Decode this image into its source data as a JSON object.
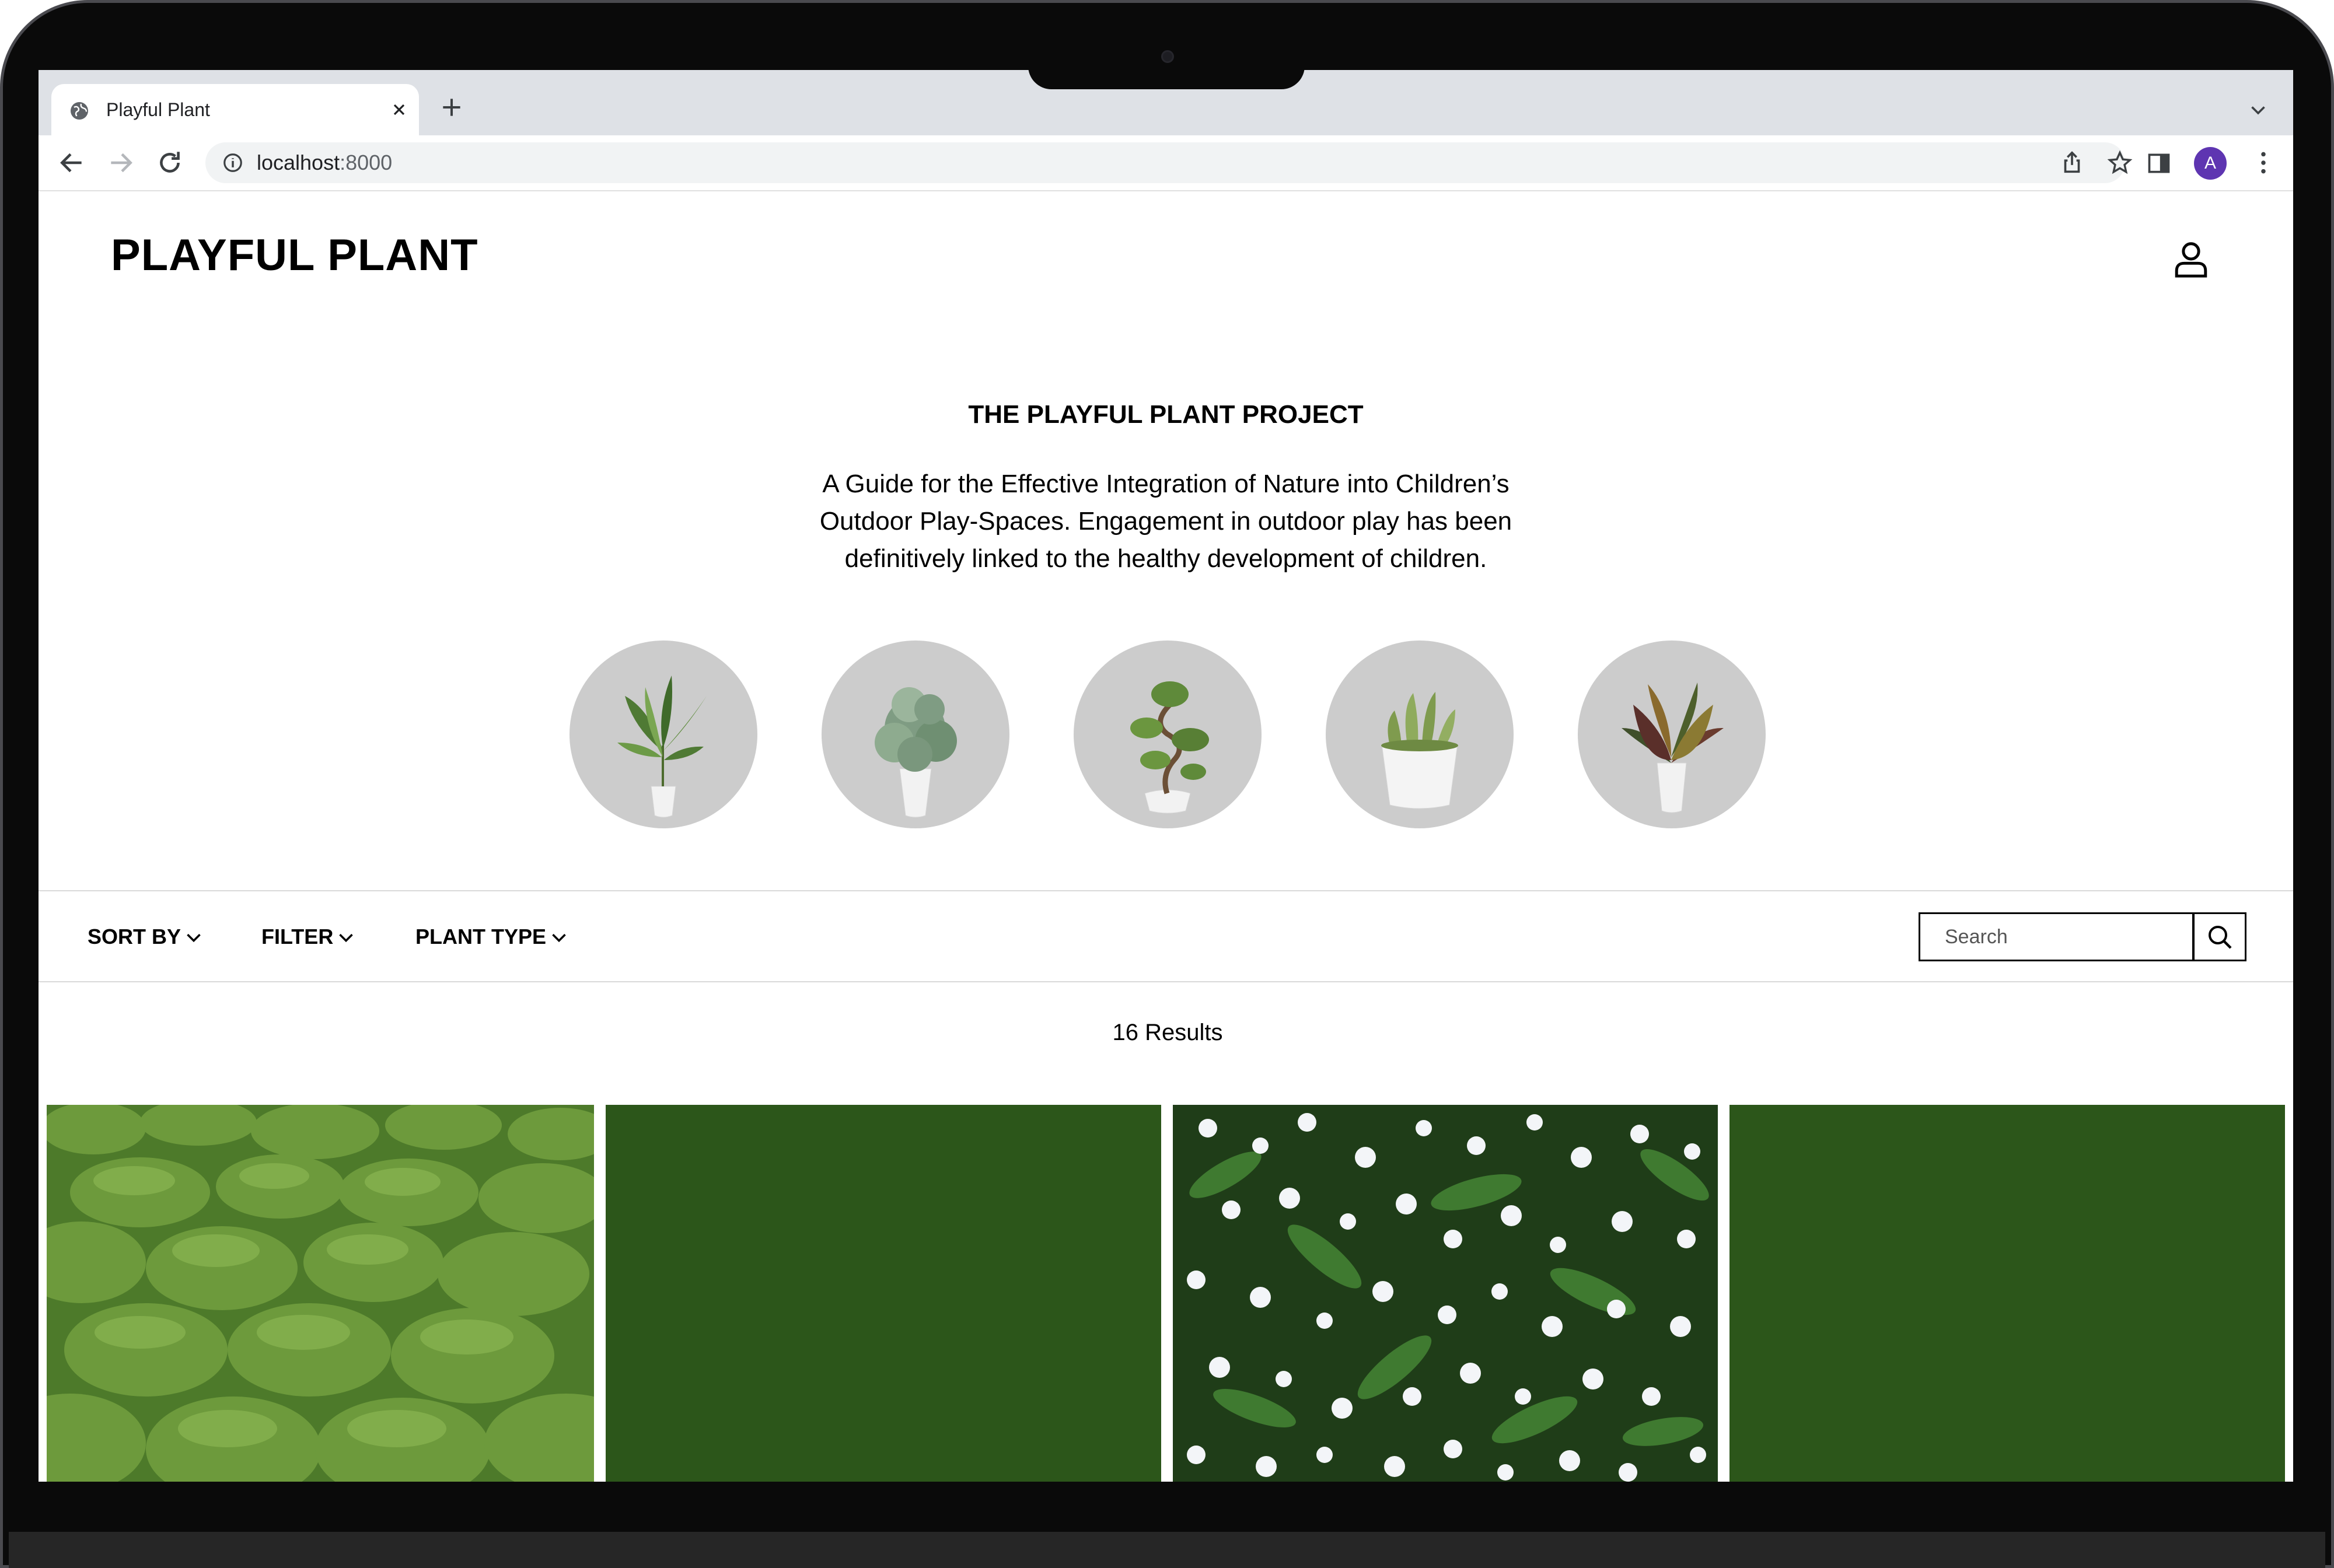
{
  "browser": {
    "tab_title": "Playful Plant",
    "url_host": "localhost",
    "url_port": ":8000",
    "profile_initial": "A"
  },
  "header": {
    "brand": "PLAYFUL PLANT"
  },
  "hero": {
    "title": "THE PLAYFUL PLANT PROJECT",
    "description": "A Guide for the Effective Integration of Nature into Children’s Outdoor Play-Spaces. Engagement in outdoor play has been definitively linked to the healthy development of children."
  },
  "categories": [
    {
      "icon": "palm-plant-icon"
    },
    {
      "icon": "leafy-bush-plant-icon"
    },
    {
      "icon": "bonsai-tree-icon"
    },
    {
      "icon": "succulent-plant-icon"
    },
    {
      "icon": "croton-plant-icon"
    }
  ],
  "toolbar": {
    "sort_label": "SORT BY",
    "filter_label": "FILTER",
    "plant_type_label": "PLANT TYPE",
    "search_placeholder": "Search"
  },
  "results": {
    "count_text": "16 Results"
  },
  "products": [
    {
      "image": "moss-photo",
      "color": "#6d9a3c"
    },
    {
      "image": "green-placeholder",
      "color": "#2c561a"
    },
    {
      "image": "white-flower-groundcover-photo",
      "color": "#2f5a26"
    },
    {
      "image": "green-placeholder",
      "color": "#2c561a"
    }
  ]
}
